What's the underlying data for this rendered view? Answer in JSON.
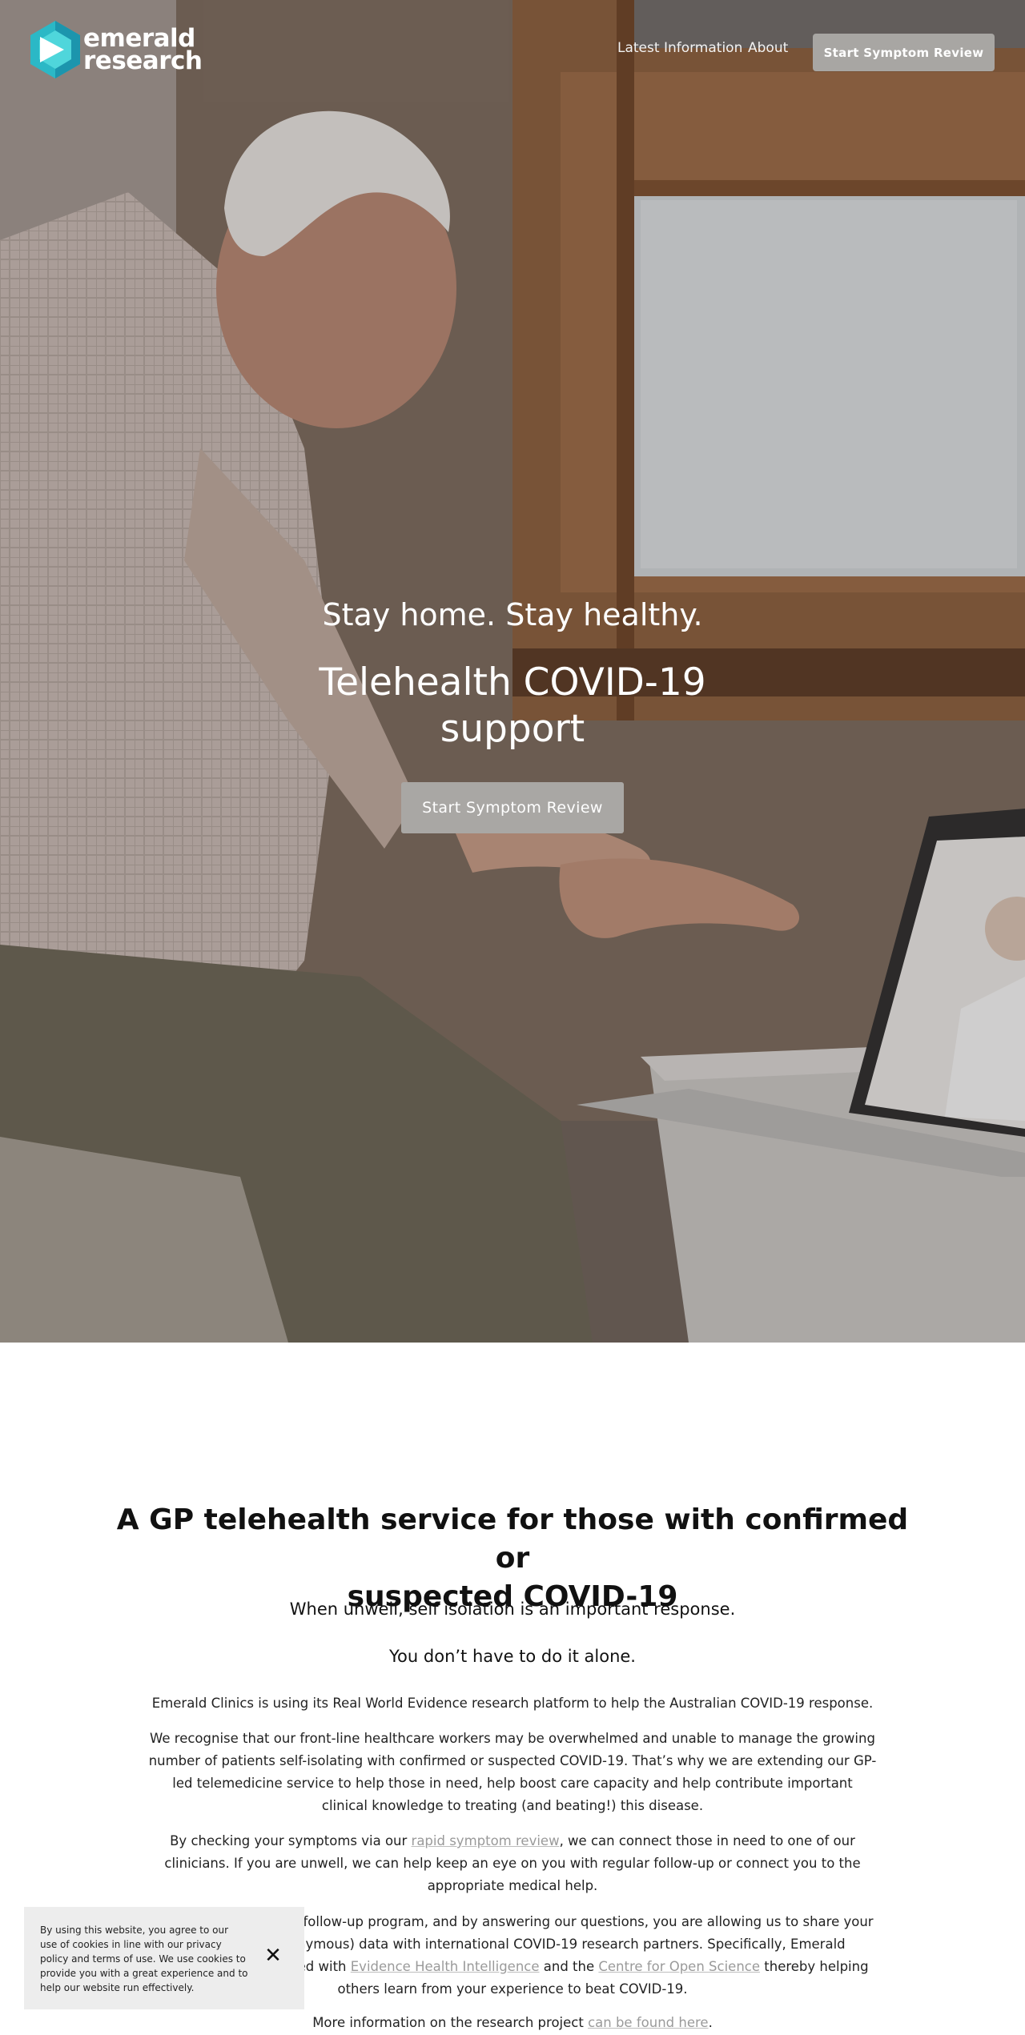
{
  "brand": {
    "name_line1": "emerald",
    "name_line2": "research",
    "colors": {
      "mark_light": "#3ccfd6",
      "mark_dark": "#1a8fa8"
    }
  },
  "nav": {
    "items": [
      {
        "label": "Latest Information"
      },
      {
        "label": "About"
      }
    ],
    "cta_label": "Start Symptom Review"
  },
  "hero": {
    "subtitle": "Stay home. Stay healthy.",
    "title_line1": "Telehealth COVID-19",
    "title_line2": "support",
    "cta_label": "Start Symptom Review"
  },
  "intro": {
    "title_line1": "A GP telehealth service for those with confirmed or",
    "title_line2": "suspected COVID-19",
    "subhead1": "When unwell, self isolation is an important response.",
    "subhead2": "You don’t have to do it alone.",
    "p1": "Emerald Clinics is using its Real World Evidence research platform to help the Australian COVID-19 response.",
    "p2": "We recognise that our front-line healthcare workers may be overwhelmed and unable to manage the growing number of patients self-isolating with confirmed or suspected COVID-19.  That’s why we are extending our GP-led telemedicine service to help those in need, help boost care capacity and help contribute important clinical knowledge to treating (and beating!) this disease.",
    "p3_before": "By checking your symptoms via our ",
    "p3_link": "rapid symptom review",
    "p3_after": ", we can connect those in need to one of our clinicians. If you are unwell, we can help keep an eye on you with regular follow-up or connect you to the appropriate medical help.",
    "p4_before": "By participating in our follow-up program, and by answering our questions, you are allowing us to share your de-identified (anonymous) data with international COVID-19 research partners. Specifically, Emerald Research has partnered with ",
    "p4_link1": "Evidence Health Intelligence",
    "p4_mid": " and the ",
    "p4_link2": "Centre for Open Science",
    "p4_after": " thereby helping others learn from your experience to beat COVID-19.",
    "p5_before": "More information on the research project ",
    "p5_link": "can be found here",
    "p5_after": "."
  },
  "cookie": {
    "text": "By using this website, you agree to our use of cookies in line with our privacy policy and terms of use. We use cookies to provide you with a great experience and to help our website run effectively.",
    "close_icon": "close-icon"
  }
}
